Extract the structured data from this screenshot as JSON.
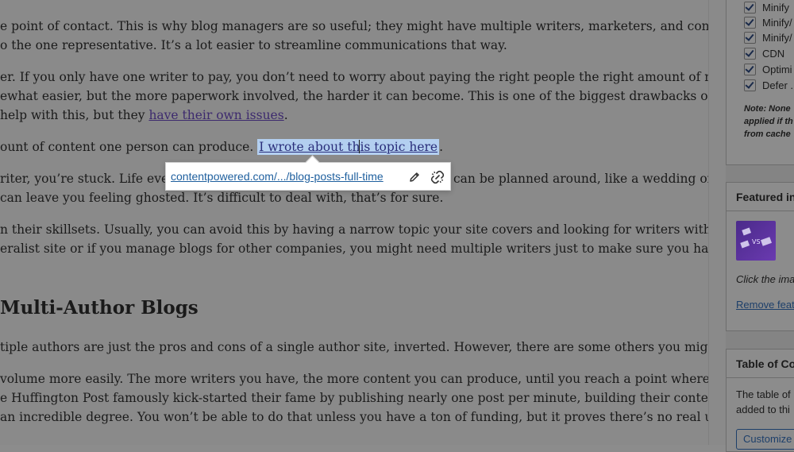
{
  "article": {
    "p1_l1": "e point of contact. This is why blog managers are so useful; they might have multiple writers, marketers, and content",
    "p1_l2": "o the one representative. It’s a lot easier to streamline communications that way.",
    "p2_l1": "er. If you only have one writer to pay, you don’t need to worry about paying the right people the right amount of money at the",
    "p2_l2": "ewhat easier, but the more paperwork involved, the harder it can become. This is one of the biggest drawbacks of multiple",
    "p2_l3_pre": " help with this, but they ",
    "p2_l3_link": "have their own issues",
    "p2_l3_post": ".",
    "p3_pre": "ount of content one person can produce. ",
    "p3_link_a": "I wrote about th",
    "p3_link_b": "is topic here",
    "p3_post": ".",
    "p4_l1_a": "riter, you’re stuck. Life events",
    "p4_l1_b": "can be planned around, like a wedding or a",
    "p4_l2": " can leave you feeling ghosted. It’s difficult to deal with, that’s for sure.",
    "p5_l1": "n their skillsets. Usually, you can avoid this by having a narrow topic your site covers and looking for writers with experience",
    "p5_l2": "eralist site or if you manage blogs for other companies, you might need multiple writers just to make sure you have the",
    "heading": "Multi-Author Blogs",
    "p6_l1": "tiple authors are just the pros and cons of a single author site, inverted. However, there are some others you might consider.",
    "p7_l1": "volume more easily. The more writers you have, the more content you can produce, until you reach a point where you’re",
    "p7_l2": "e Huffington Post famously kick-started their fame by publishing nearly one post per minute, building their content library,",
    "p7_l3": "an incredible degree. You won’t be able to do that unless you have a ton of funding, but it proves there’s no real upper limit."
  },
  "link_popover": {
    "url": "contentpowered.com/.../blog-posts-full-time",
    "edit_icon": "pencil-icon",
    "unlink_icon": "unlink-icon"
  },
  "sidebar": {
    "options": [
      {
        "label": "Minify",
        "checked": true
      },
      {
        "label": "Minify/",
        "checked": true
      },
      {
        "label": "Minify/",
        "checked": true
      },
      {
        "label": "CDN",
        "checked": true
      },
      {
        "label": "Optimi",
        "checked": true
      },
      {
        "label": "Defer .",
        "checked": true
      }
    ],
    "note_l1": "Note: None",
    "note_l2": "applied if th",
    "note_l3": "from cache",
    "featured_title": "Featured in",
    "featured_hint": "Click the ima",
    "featured_remove": "Remove feat",
    "toc_title": "Table of Co",
    "toc_text_l1": "The table of",
    "toc_text_l2": "added to thi",
    "toc_button": "Customize"
  },
  "colors": {
    "overlay": "#8a8a8a",
    "link": "#1e5f9e",
    "selection": "#b3cff0"
  }
}
